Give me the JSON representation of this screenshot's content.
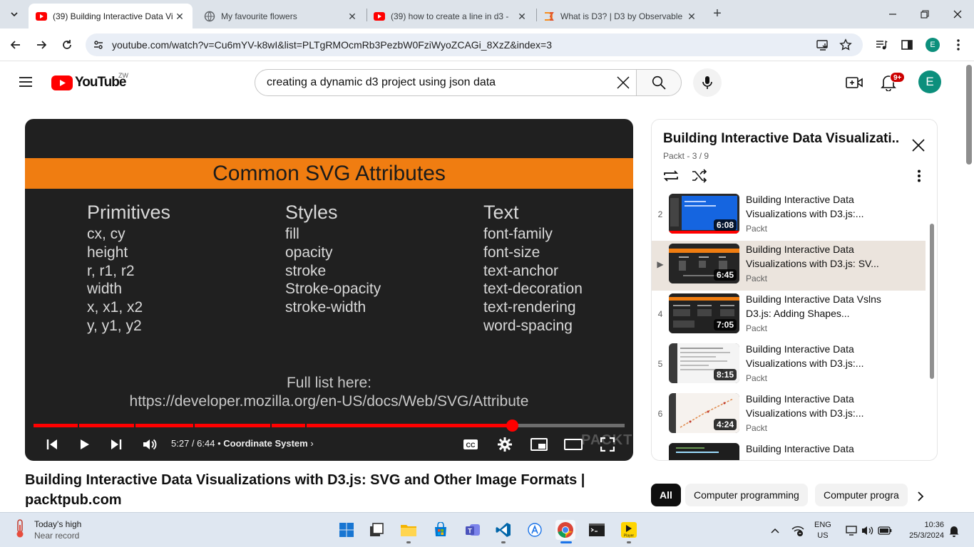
{
  "browser": {
    "tabs": [
      {
        "title": "(39) Building Interactive Data Vi",
        "favicon": "youtube-icon",
        "active": true
      },
      {
        "title": "My favourite flowers",
        "favicon": "globe-icon",
        "active": false
      },
      {
        "title": "(39) how to create a line in d3 -",
        "favicon": "youtube-icon",
        "active": false
      },
      {
        "title": "What is D3? | D3 by Observable",
        "favicon": "d3-icon",
        "active": false
      }
    ],
    "url": "youtube.com/watch?v=Cu6mYV-k8wI&list=PLTgRMOcmRb3PezbW0FziWyoZCAGi_8XzZ&index=3",
    "profile_initial": "E"
  },
  "youtube": {
    "logo_text": "YouTube",
    "region": "ZW",
    "search_query": "creating a dynamic d3 project using json data",
    "notification_count": "9+",
    "avatar_initial": "E"
  },
  "slide": {
    "heading": "Common SVG Attributes",
    "columns": [
      {
        "title": "Primitives",
        "items": [
          "cx, cy",
          "height",
          "r, r1, r2",
          "width",
          "x, x1, x2",
          "y, y1, y2"
        ]
      },
      {
        "title": "Styles",
        "items": [
          "fill",
          "opacity",
          "stroke",
          "Stroke-opacity",
          "stroke-width"
        ]
      },
      {
        "title": "Text",
        "items": [
          "font-family",
          "font-size",
          "text-anchor",
          "text-decoration",
          "text-rendering",
          "word-spacing"
        ]
      }
    ],
    "full_list_label": "Full list here:",
    "full_list_url": "https://developer.mozilla.org/en-US/docs/Web/SVG/Attribute",
    "watermark": "PACKT"
  },
  "player": {
    "time": "5:27 / 6:44",
    "chapter": "Coordinate System",
    "played_fraction": 0.81,
    "chapter_markers": [
      0.075,
      0.17,
      0.27,
      0.4,
      0.46
    ]
  },
  "video_title": "Building Interactive Data Visualizations with D3.js: SVG and Other Image Formats | packtpub.com",
  "playlist": {
    "title": "Building Interactive Data Visualizati...",
    "channel": "Packt",
    "position": "- 3 / 9",
    "items": [
      {
        "index": "2",
        "title": "Building Interactive Data Visualizations with D3.js:...",
        "channel": "Packt",
        "duration": "6:08",
        "thumb": "blue-code"
      },
      {
        "index": "▶",
        "title": "Building Interactive Data Visualizations with D3.js: SV...",
        "channel": "Packt",
        "duration": "6:45",
        "thumb": "slide"
      },
      {
        "index": "4",
        "title": "Building Interactive Data Vslns D3.js: Adding Shapes...",
        "channel": "Packt",
        "duration": "7:05",
        "thumb": "slide"
      },
      {
        "index": "5",
        "title": "Building Interactive Data Visualizations with D3.js:...",
        "channel": "Packt",
        "duration": "8:15",
        "thumb": "doc"
      },
      {
        "index": "6",
        "title": "Building Interactive Data Visualizations with D3.js:...",
        "channel": "Packt",
        "duration": "4:24",
        "thumb": "chart"
      },
      {
        "index": "",
        "title": "Building Interactive Data",
        "channel": "",
        "duration": "",
        "thumb": "dark-code"
      }
    ]
  },
  "chips": [
    "All",
    "Computer programming",
    "Computer progra"
  ],
  "taskbar": {
    "weather_title": "Today's high",
    "weather_sub": "Near record",
    "lang_top": "ENG",
    "lang_bottom": "US",
    "time": "10:36",
    "date": "25/3/2024"
  },
  "colors": {
    "youtube_red": "#ff0000",
    "slide_orange": "#f07d11",
    "accent_blue": "#1a73e8"
  }
}
